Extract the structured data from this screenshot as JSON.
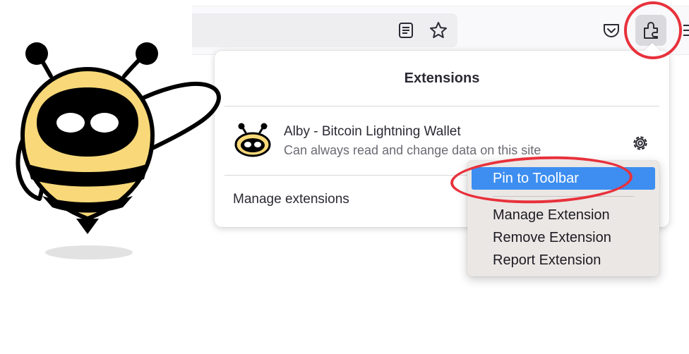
{
  "panel": {
    "title": "Extensions",
    "manage_label": "Manage extensions"
  },
  "extension": {
    "name": "Alby - Bitcoin Lightning Wallet",
    "description": "Can always read and change data on this site"
  },
  "context_menu": {
    "items": [
      {
        "label": "Pin to Toolbar",
        "selected": true
      },
      {
        "label": "Manage Extension"
      },
      {
        "label": "Remove Extension"
      },
      {
        "label": "Report Extension"
      }
    ]
  },
  "toolbar": {
    "icons": [
      "reader-view-icon",
      "bookmark-star-icon",
      "pocket-icon",
      "extensions-puzzle-icon",
      "menu-more-icon"
    ]
  },
  "colors": {
    "accent": "#3d8ef0",
    "annotation": "#e8313b",
    "bee_yellow": "#f8d878",
    "bee_black": "#000000"
  }
}
